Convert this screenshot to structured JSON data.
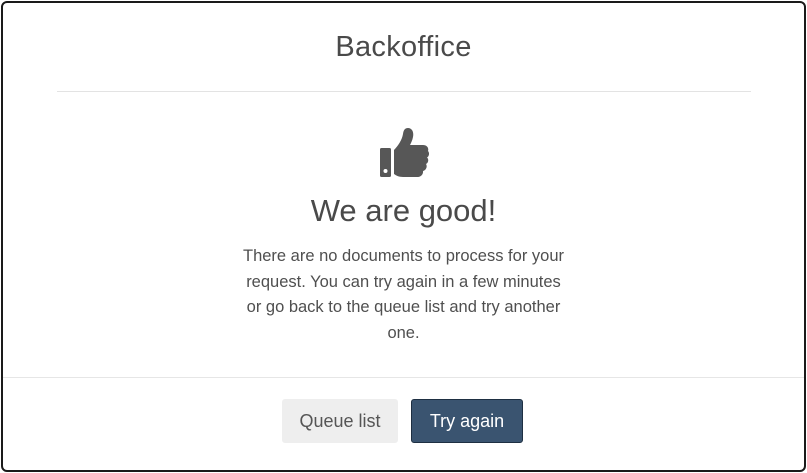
{
  "dialog": {
    "title": "Backoffice",
    "icon": "thumbs-up-icon",
    "heading": "We are good!",
    "message": "There are no documents to process for your request. You can try again in a few minutes or go back to the queue list and try another one.",
    "buttons": {
      "queue_list": "Queue list",
      "try_again": "Try again"
    }
  },
  "colors": {
    "primary": "#3a5470",
    "secondary": "#eeeeee",
    "text": "#4a4a4a"
  }
}
